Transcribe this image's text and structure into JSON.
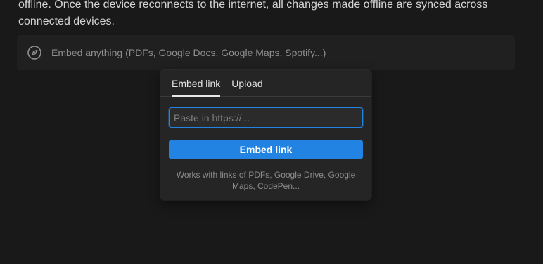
{
  "paragraph": {
    "line1": "offline. Once the device reconnects to the internet, all changes made offline are synced across",
    "line2": "connected devices."
  },
  "embed_block": {
    "icon": "compass-icon",
    "placeholder": "Embed anything (PDFs, Google Docs, Google Maps, Spotify...)"
  },
  "popover": {
    "tabs": [
      {
        "label": "Embed link",
        "active": true
      },
      {
        "label": "Upload",
        "active": false
      }
    ],
    "input": {
      "value": "",
      "placeholder": "Paste in https://..."
    },
    "button_label": "Embed link",
    "hint": "Works with links of PDFs, Google Drive, Google Maps, CodePen..."
  },
  "colors": {
    "background": "#191919",
    "accent": "#2383e2",
    "popover": "#252525"
  }
}
